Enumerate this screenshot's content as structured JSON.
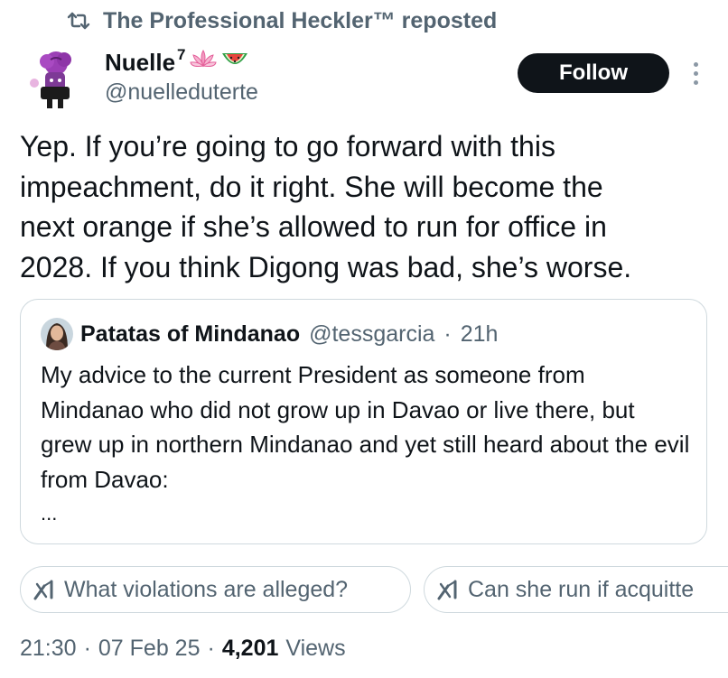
{
  "repost": {
    "icon": "repost-icon",
    "text": "The Professional Heckler™ reposted"
  },
  "author": {
    "avatar": "purple-cartoon-avatar",
    "name": "Nuelle",
    "name_sup": "7",
    "name_emojis": [
      "lotus-emoji",
      "watermelon-emoji"
    ],
    "handle": "@nuelleduterte"
  },
  "follow_label": "Follow",
  "more_icon": "more-options-icon",
  "tweet_text": "Yep. If you’re going to go forward with this\nimpeachment, do it right. She will become the\nnext orange if she’s allowed to run for office in\n2028. If you think Digong was bad, she’s worse.",
  "quote": {
    "avatar": "profile-photo-avatar",
    "name": "Patatas of Mindanao",
    "handle": "@tessgarcia",
    "separator": "·",
    "time": "21h",
    "text": "My advice to the current President as someone from Mindanao who did not grow up in Davao or live there, but grew up in northern Mindanao and yet still heard about the evil from Davao:",
    "ellipsis": "..."
  },
  "suggestions": [
    {
      "icon": "grok-icon",
      "label": "What violations are alleged?"
    },
    {
      "icon": "grok-icon",
      "label": "Can she run if acquitte"
    }
  ],
  "footer": {
    "time": "21:30",
    "sep1": "·",
    "date": "07 Feb 25",
    "sep2": "·",
    "views_count": "4,201",
    "views_label": "Views"
  },
  "colors": {
    "text": "#0f1419",
    "secondary": "#536471",
    "border": "#cfd9de",
    "follow_bg": "#0f1419"
  }
}
